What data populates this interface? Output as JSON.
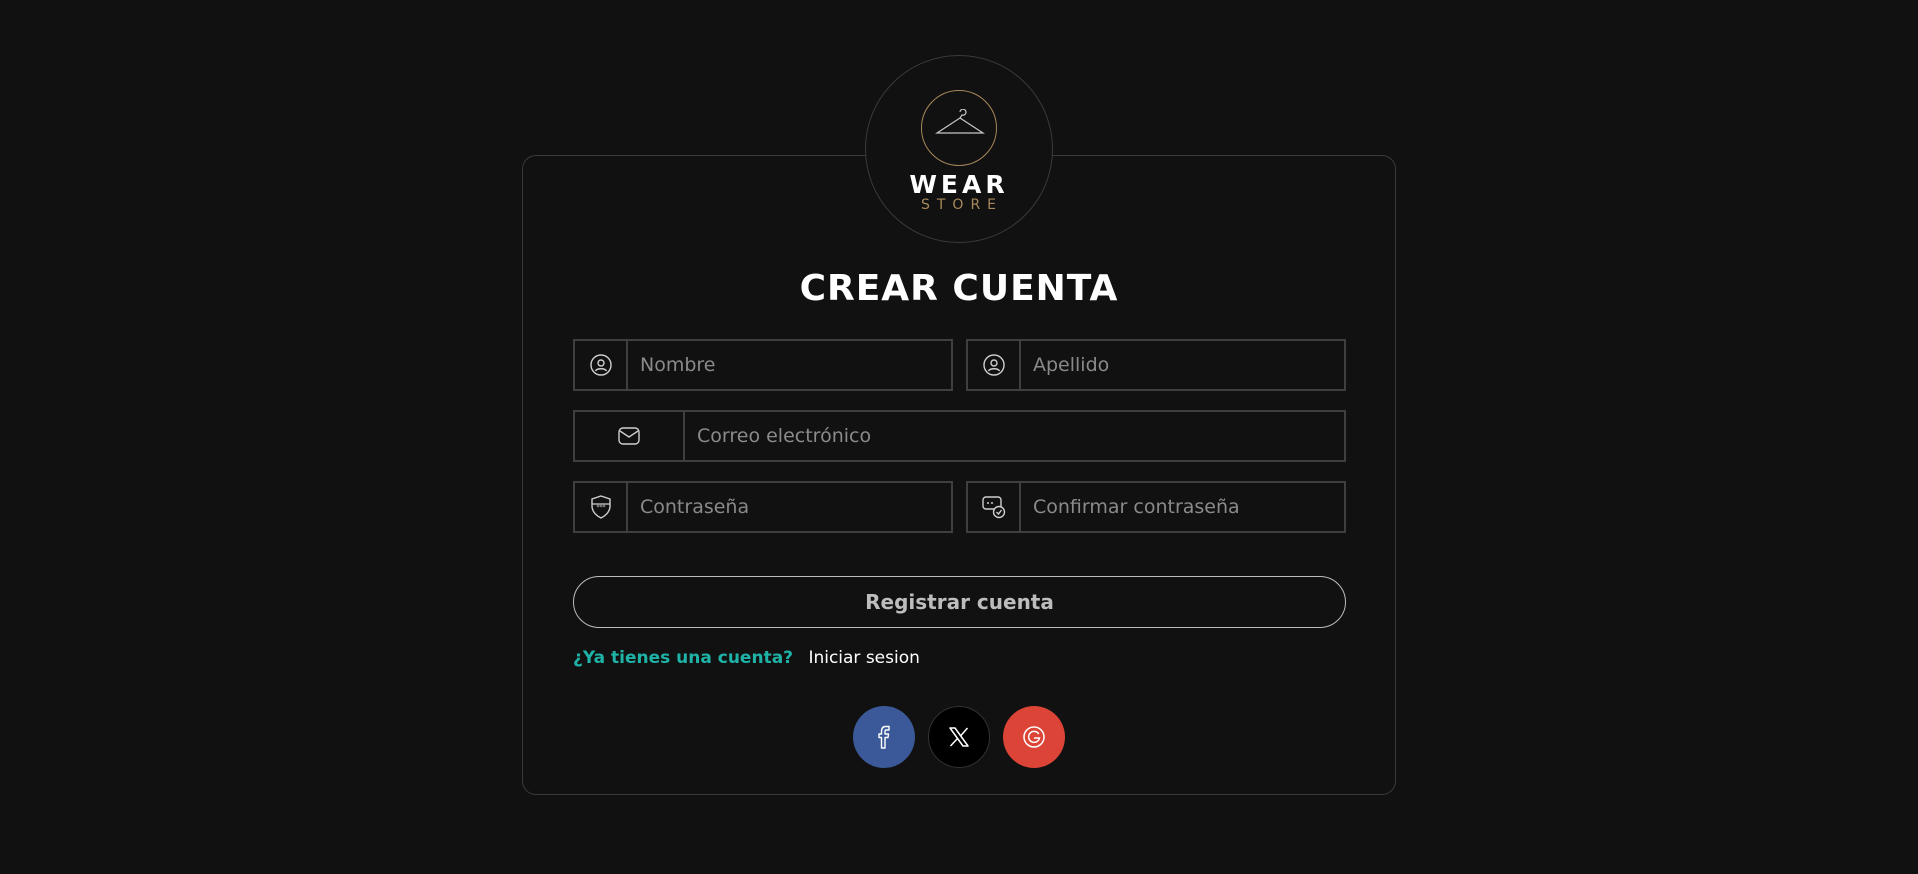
{
  "brand": {
    "word": "WEAR",
    "sub": "STORE",
    "accent_color": "#a8885a"
  },
  "form": {
    "title": "CREAR CUENTA",
    "fields": {
      "first_name": {
        "placeholder": "Nombre",
        "icon": "user-circle-icon"
      },
      "last_name": {
        "placeholder": "Apellido",
        "icon": "user-circle-icon"
      },
      "email": {
        "placeholder": "Correo electrónico",
        "icon": "envelope-icon"
      },
      "password": {
        "placeholder": "Contraseña",
        "icon": "shield-password-icon"
      },
      "confirm_password": {
        "placeholder": "Confirmar contraseña",
        "icon": "password-check-icon"
      }
    },
    "submit_label": "Registrar cuenta",
    "have_account_text": "¿Ya tienes una cuenta?",
    "login_link": "Iniciar sesion"
  },
  "social": [
    {
      "name": "facebook",
      "icon": "facebook-icon",
      "color": "#3b5998"
    },
    {
      "name": "x",
      "icon": "x-icon",
      "color": "#000000"
    },
    {
      "name": "google",
      "icon": "google-icon",
      "color": "#db4437"
    }
  ],
  "colors": {
    "background": "#111111",
    "link_accent": "#1fb3a7",
    "border": "#3f3f3f"
  }
}
